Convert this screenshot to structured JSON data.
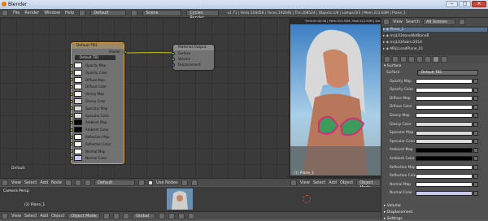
{
  "window": {
    "title": "Blender",
    "buttons": [
      "−",
      "□",
      "✕"
    ]
  },
  "menu": {
    "items": [
      "File",
      "Render",
      "Window",
      "Help"
    ],
    "screen_layout": "Default",
    "scene": "Scene",
    "engine": "Cycles Render",
    "stats": "v2.71 | Verts:104458 | Faces:192046 | Tris:208524 | Objects:1/8 | Lamps:0/3 | Mem:313.63M | Plane_1"
  },
  "node_editor": {
    "material_node": {
      "title": "Default TB1",
      "output_label": "Shader",
      "material_field": "Default TB1",
      "inputs": [
        "Opacity Map",
        "Opacity Color",
        "Diffuse Map",
        "Diffuse Color",
        "Glossy Map",
        "Glossy Color",
        "Specular Map",
        "Specular Color",
        "Ambient Map",
        "Ambient Color",
        "Reflection Map",
        "Reflection Color",
        "Normal Map",
        "Normal Color"
      ],
      "swatch_colors": [
        "#ffffff",
        "#ffffff",
        "#ffffff",
        "#ffffff",
        "#ffffff",
        "#dcdcdc",
        "#dcdcdc",
        "#dcdcdc",
        "#000000",
        "#000000",
        "#ffffff",
        "#ffffff",
        "#ffffff",
        "#c8c8f0"
      ]
    },
    "output_node": {
      "title": "Material Output",
      "inputs": [
        "Surface",
        "Volume",
        "Displacement"
      ]
    },
    "corner_label": "Default",
    "header": {
      "items": [
        "View",
        "Select",
        "Add",
        "Node"
      ],
      "material": "Default",
      "use_nodes": "Use Nodes"
    }
  },
  "viewport": {
    "overlay_top": "Time:00:45.08 | Mem:313.90M, Peak:313.90M | Done | Path Tracing Sample 1",
    "object_label": "(1) Plane_1",
    "header_items": [
      "View",
      "Select",
      "Add",
      "Object"
    ],
    "mode": "Object Mode"
  },
  "timeline": {
    "camera_label": "Camera Persp",
    "object_label": "(2) Plane_1",
    "header_items": [
      "View",
      "Select",
      "Add",
      "Object"
    ],
    "mode": "Object Mode",
    "orientation": "Global"
  },
  "outliner": {
    "header_items": [
      "View",
      "Search",
      "All Scenes"
    ],
    "rows": [
      "Plane_1",
      "mrjL03doneNotBoneB",
      "mrjL03Fabric2014",
      "MRjLLeadPlane_01"
    ]
  },
  "properties": {
    "section_surface": "Surface",
    "surface_label": "Surface",
    "surface_value": "Default TB1",
    "rows": [
      "Opacity Map",
      "Opacity Color",
      "Diffuse Map",
      "Diffuse Color",
      "Glossy Map",
      "Glossy Color",
      "Specular Map",
      "Specular Color",
      "Ambient Map",
      "Ambient Color",
      "Reflection Map",
      "Reflection Color",
      "Normal Map",
      "Normal Color"
    ],
    "row_colors": [
      "#ffffff",
      "#ffffff",
      "#ffffff",
      "#ffffff",
      "#ffffff",
      "#dcdcdc",
      "#dcdcdc",
      "#dcdcdc",
      "#000000",
      "#000000",
      "#ffffff",
      "#ffffff",
      "#ffffff",
      "#c8c8f0"
    ],
    "sections_collapsed": [
      "Volume",
      "Displacement",
      "Settings"
    ]
  }
}
